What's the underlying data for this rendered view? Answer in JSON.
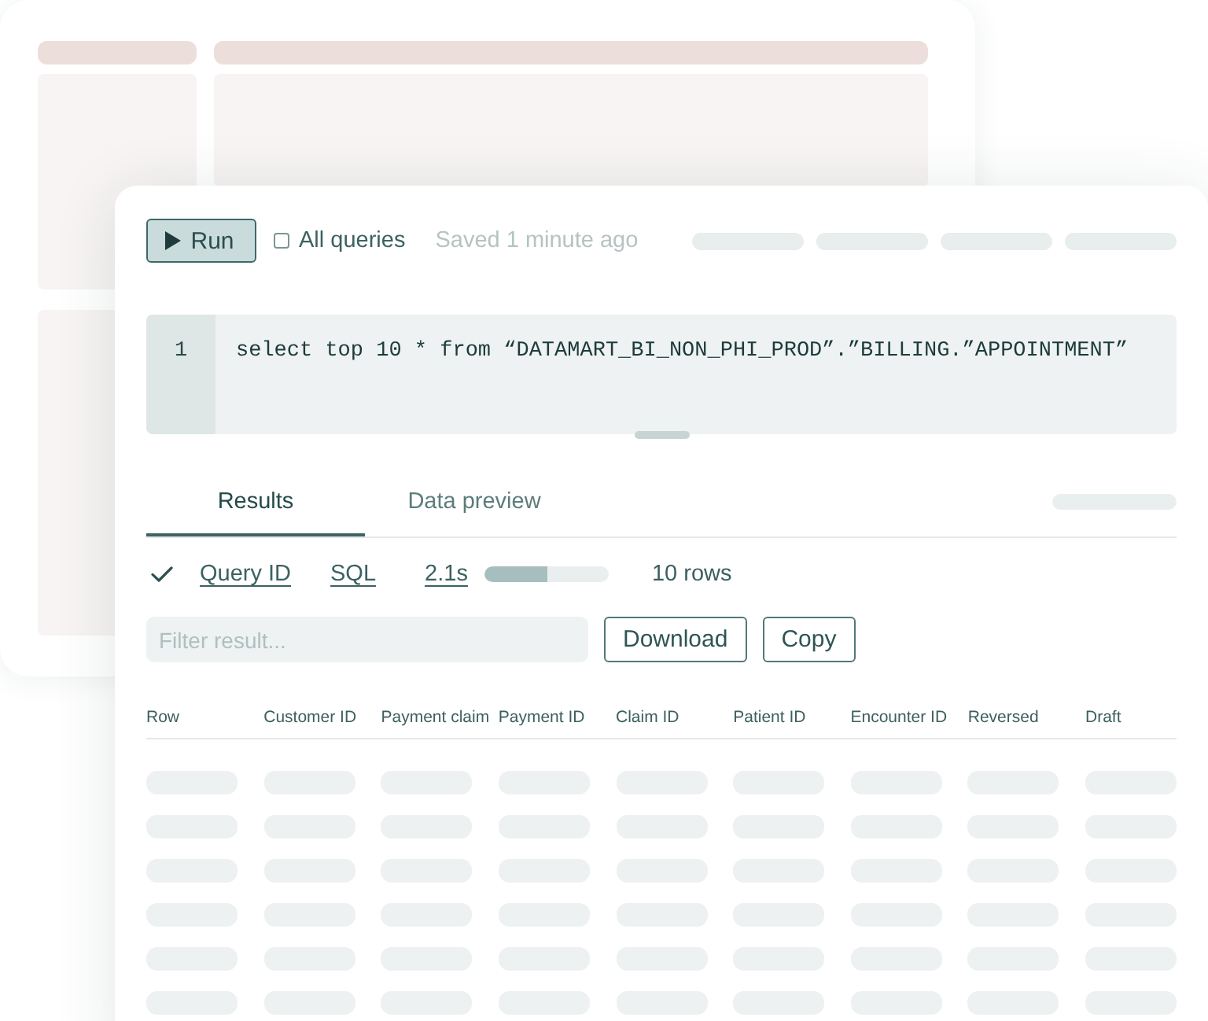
{
  "toolbar": {
    "run_button": {
      "label": "Run"
    },
    "all_queries": {
      "label": "All queries",
      "checked": false
    },
    "save_status": "Saved 1 minute ago"
  },
  "editor": {
    "lines": [
      {
        "number": "1",
        "code": "select top 10 * from “DATAMART_BI_NON_PHI_PROD”.”BILLING.”APPOINTMENT”"
      }
    ]
  },
  "tabs": [
    {
      "label": "Results",
      "selected": true
    },
    {
      "label": "Data preview",
      "selected": false
    }
  ],
  "status": {
    "succeeded": true,
    "links": [
      "Query ID",
      "SQL",
      "2.1s"
    ],
    "progress": {
      "level": 0.5
    },
    "row_count": "10 rows"
  },
  "filter": {
    "placeholder": "Filter result..."
  },
  "buttons": [
    "Download",
    "Copy"
  ],
  "table": {
    "columns": [
      "Row",
      "Customer ID",
      "Payment claim",
      "Payment ID",
      "Claim ID",
      "Patient ID",
      "Encounter ID",
      "Reversed",
      "Draft"
    ]
  }
}
